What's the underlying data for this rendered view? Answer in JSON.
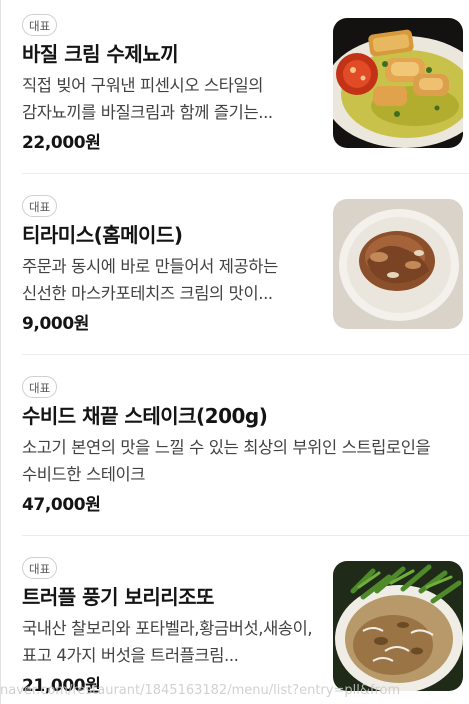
{
  "menu": {
    "items": [
      {
        "badge": "대표",
        "name": "바질 크림 수제뇨끼",
        "description": "직접 빚어 구워낸 피센시오 스타일의 감자뇨끼를 바질크림과 함께 즐기는...",
        "price": "22,000원",
        "image_icon": "gnocchi-dish-photo"
      },
      {
        "badge": "대표",
        "name": "티라미스(홈메이드)",
        "description": "주문과 동시에 바로 만들어서 제공하는 신선한 마스카포테치즈 크림의 맛이...",
        "price": "9,000원",
        "image_icon": "tiramisu-dish-photo"
      },
      {
        "badge": "대표",
        "name": "수비드 채끝 스테이크(200g)",
        "description": "소고기 본연의 맛을 느낄 수 있는 최상의 부위인 스트립로인을 수비드한 스테이크",
        "price": "47,000원"
      },
      {
        "badge": "대표",
        "name": "트러플 풍기 보리리조또",
        "description": "국내산 찰보리와 포타벨라,황금버섯,새송이,표고 4가지 버섯을 트러플크림...",
        "price": "21,000원",
        "image_icon": "risotto-dish-photo"
      }
    ]
  },
  "status_url": "naver.com/restaurant/1845163182/menu/list?entry=pll&from"
}
